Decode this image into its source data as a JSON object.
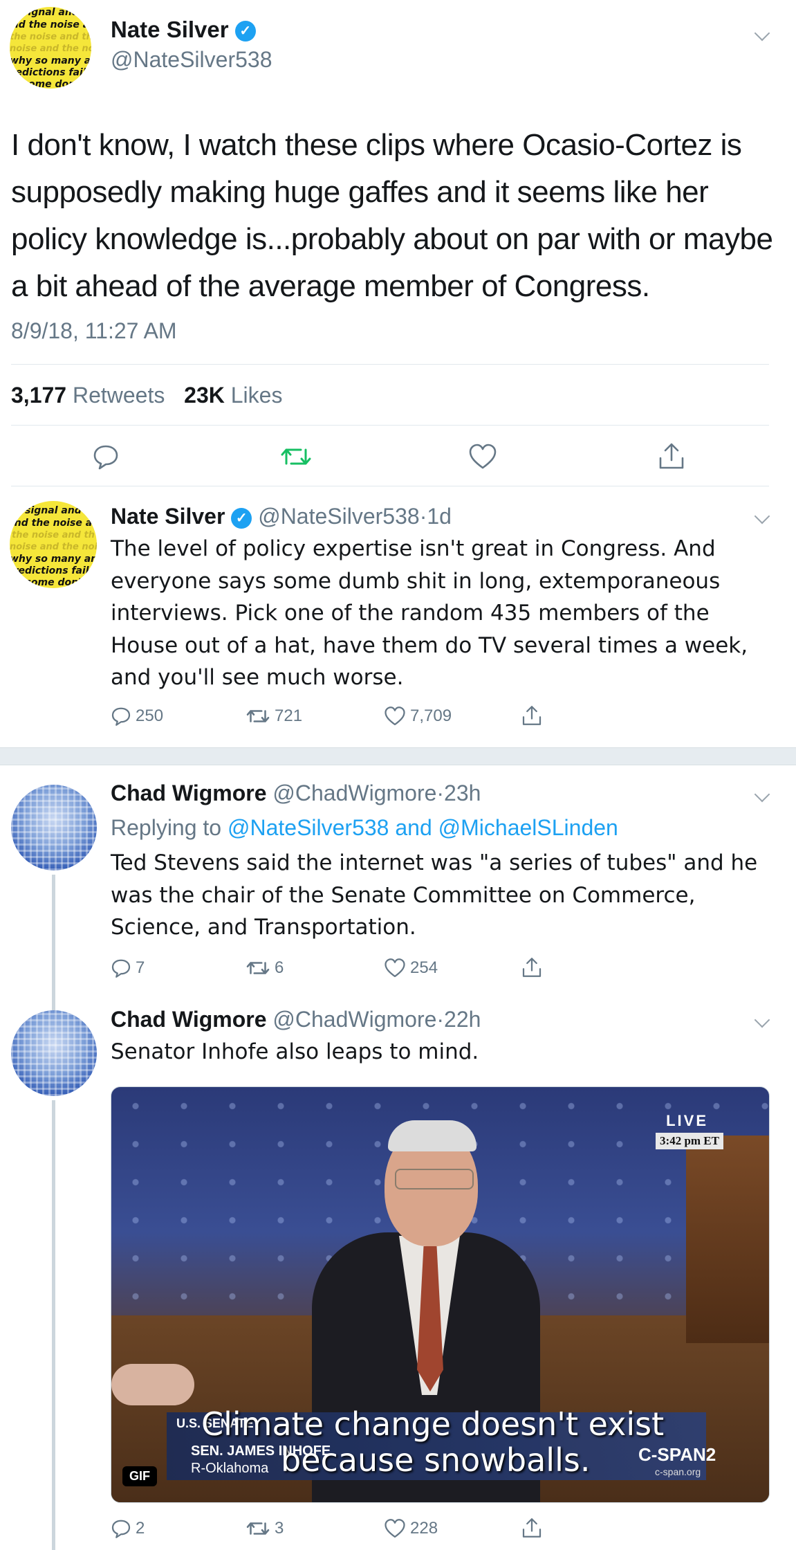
{
  "main_tweet": {
    "avatar_text": [
      "signal and",
      "nd the noise a",
      "the noise and th",
      "noise and the noi",
      "why so many an",
      "redictions fail-",
      "some don'"
    ],
    "name": "Nate Silver",
    "handle": "@NateSilver538",
    "text": "I don't know, I watch these clips where Ocasio-Cortez is supposedly making huge gaffes and it seems like her policy knowledge is...probably about on par with or maybe a bit ahead of the average member of Congress.",
    "timestamp": "8/9/18, 11:27 AM",
    "retweets_count": "3,177",
    "retweets_label": "Retweets",
    "likes_count": "23K",
    "likes_label": "Likes"
  },
  "reply_1": {
    "name": "Nate Silver",
    "handle": "@NateSilver538",
    "separator": "·",
    "time": "1d",
    "text": "The level of policy expertise isn't great in Congress. And everyone says some dumb shit in long, extemporaneous interviews. Pick one of the random 435 members of the House out of a hat, have them do TV several times a week, and you'll see much worse.",
    "replies": "250",
    "retweets": "721",
    "likes": "7,709"
  },
  "reply_2": {
    "name": "Chad Wigmore",
    "handle": "@ChadWigmore",
    "separator": "·",
    "time": "23h",
    "replying_prefix": "Replying to",
    "replying_to": "@NateSilver538 and @MichaelSLinden",
    "text": "Ted Stevens said the internet was \"a series of tubes\" and he was the chair of the Senate Committee on Commerce, Science, and Transportation.",
    "replies": "7",
    "retweets": "6",
    "likes": "254"
  },
  "reply_3": {
    "name": "Chad Wigmore",
    "handle": "@ChadWigmore",
    "separator": "·",
    "time": "22h",
    "text": "Senator Inhofe also leaps to mind.",
    "media": {
      "live": "LIVE",
      "clock": "3:42 pm ET",
      "lower_third_tag": "U.S. SENATE",
      "caption_line1": "Climate change doesn't exist",
      "caption_line2": "because snowballs.",
      "lower_third_name": "SEN. JAMES INHOFE",
      "lower_third_party": "R-Oklahoma",
      "network": "C-SPAN2",
      "network_url": "c-span.org",
      "gif_badge": "GIF"
    },
    "replies": "2",
    "retweets": "3",
    "likes": "228"
  },
  "colors": {
    "accent": "#1da1f2",
    "retweet_green": "#17bf63",
    "muted": "#657786"
  }
}
